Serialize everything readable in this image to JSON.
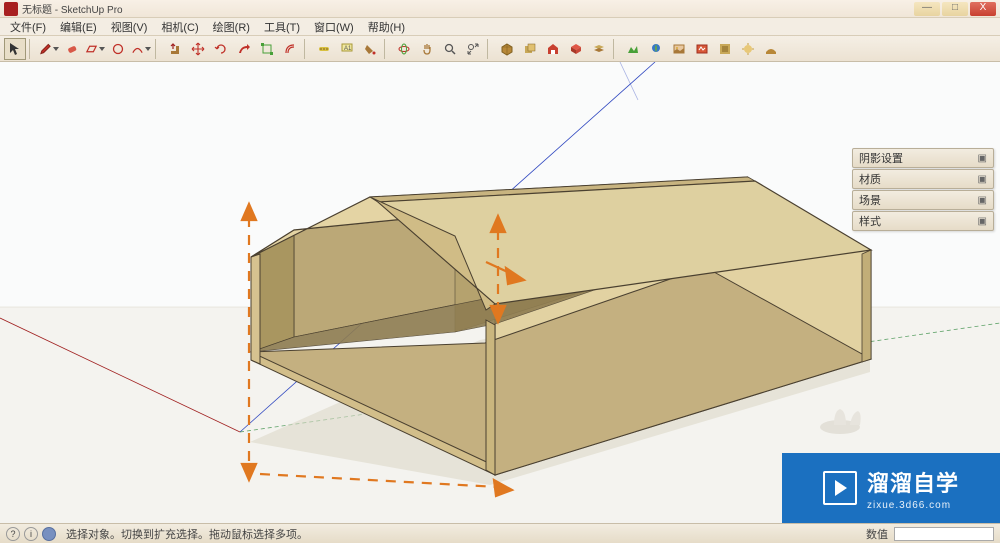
{
  "window": {
    "title": "无标题 - SketchUp Pro",
    "min": "—",
    "max": "□",
    "close": "X"
  },
  "menu": {
    "file": "文件(F)",
    "edit": "编辑(E)",
    "view": "视图(V)",
    "camera": "相机(C)",
    "draw": "绘图(R)",
    "tools": "工具(T)",
    "window": "窗口(W)",
    "help": "帮助(H)"
  },
  "panels": {
    "shadows": "阴影设置",
    "materials": "材质",
    "scenes": "场景",
    "styles": "样式"
  },
  "status": {
    "hint": "选择对象。切换到扩充选择。拖动鼠标选择多项。",
    "measure_label": "数值",
    "measure_value": ""
  },
  "watermark": {
    "main": "溜溜自学",
    "sub": "zixue.3d66.com"
  }
}
